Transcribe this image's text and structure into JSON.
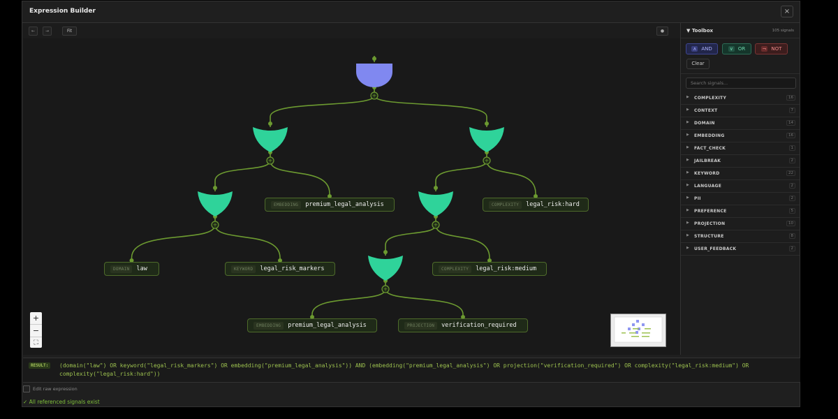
{
  "window": {
    "title": "Expression Builder",
    "close_icon": "×"
  },
  "canvas_toolbar": {
    "undo_label": "←",
    "redo_label": "→",
    "fit_label": "Fit",
    "settings_icon": "●"
  },
  "graph": {
    "leaves": [
      {
        "tag": "EMBEDDING",
        "name": "premium_legal_analysis"
      },
      {
        "tag": "COMPLEXITY",
        "name": "legal_risk:hard"
      },
      {
        "tag": "DOMAIN",
        "name": "law"
      },
      {
        "tag": "KEYWORD",
        "name": "legal_risk_markers"
      },
      {
        "tag": "COMPLEXITY",
        "name": "legal_risk:medium"
      },
      {
        "tag": "EMBEDDING",
        "name": "premium_legal_analysis"
      },
      {
        "tag": "PROJECTION",
        "name": "verification_required"
      }
    ],
    "colors": {
      "and_gate": "#8088f0",
      "or_gate": "#2fd39a",
      "edge": "#6c9a30",
      "leaf_border": "#4e6b2b"
    }
  },
  "zoom": {
    "in": "+",
    "out": "−",
    "fit": "⛶"
  },
  "toolbox": {
    "title": "▼ Toolbox",
    "count": "105 signals",
    "and_symbol": "∧",
    "and_label": "AND",
    "or_symbol": "∨",
    "or_label": "OR",
    "not_symbol": "¬",
    "not_label": "NOT",
    "clear_label": "Clear",
    "search_placeholder": "Search signals...",
    "categories": [
      {
        "label": "COMPLEXITY",
        "count": "16"
      },
      {
        "label": "CONTEXT",
        "count": "7"
      },
      {
        "label": "DOMAIN",
        "count": "14"
      },
      {
        "label": "EMBEDDING",
        "count": "16"
      },
      {
        "label": "FACT_CHECK",
        "count": "1"
      },
      {
        "label": "JAILBREAK",
        "count": "2"
      },
      {
        "label": "KEYWORD",
        "count": "22"
      },
      {
        "label": "LANGUAGE",
        "count": "2"
      },
      {
        "label": "PII",
        "count": "2"
      },
      {
        "label": "PREFERENCE",
        "count": "5"
      },
      {
        "label": "PROJECTION",
        "count": "10"
      },
      {
        "label": "STRUCTURE",
        "count": "8"
      },
      {
        "label": "USER_FEEDBACK",
        "count": "2"
      }
    ]
  },
  "result": {
    "label": "RESULT:",
    "expression": "(domain(\"law\") OR keyword(\"legal_risk_markers\") OR embedding(\"premium_legal_analysis\")) AND (embedding(\"premium_legal_analysis\") OR projection(\"verification_required\") OR complexity(\"legal_risk:medium\") OR complexity(\"legal_risk:hard\"))"
  },
  "edit_raw_label": "Edit raw expression",
  "validation": "✓ All referenced signals exist"
}
